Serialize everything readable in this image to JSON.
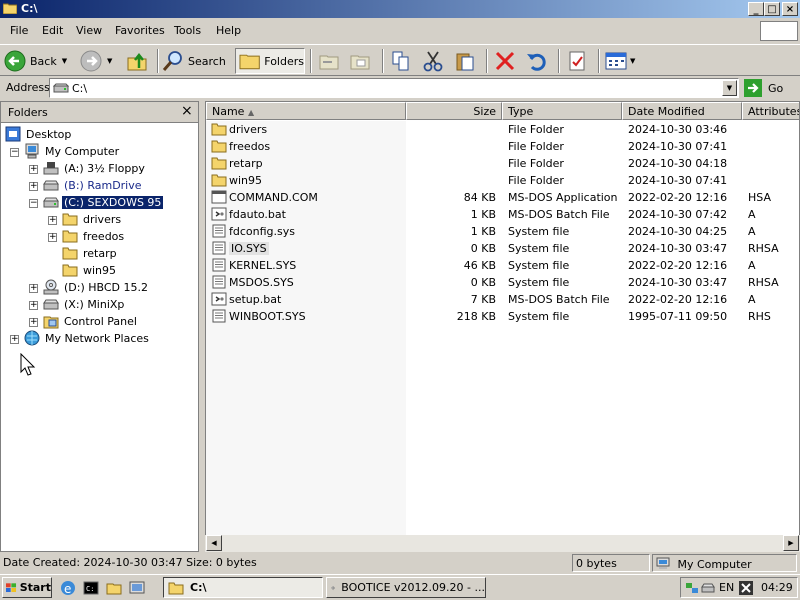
{
  "window": {
    "title": "C:\\",
    "min": "_",
    "max": "□",
    "close": "×"
  },
  "menu": [
    "File",
    "Edit",
    "View",
    "Favorites",
    "Tools",
    "Help"
  ],
  "toolbar": {
    "back": "Back",
    "search": "Search",
    "folders": "Folders"
  },
  "address": {
    "label": "Address",
    "value": "C:\\",
    "go": "Go"
  },
  "folders_pane": {
    "title": "Folders",
    "close": "×",
    "items": [
      {
        "label": "Desktop"
      },
      {
        "label": "My Computer"
      },
      {
        "label": "(A:) 3½ Floppy"
      },
      {
        "label": "(B:) RamDrive"
      },
      {
        "label": "(C:) SEXDOWS 95"
      },
      {
        "label": "drivers"
      },
      {
        "label": "freedos"
      },
      {
        "label": "retarp"
      },
      {
        "label": "win95"
      },
      {
        "label": "(D:) HBCD 15.2"
      },
      {
        "label": "(X:) MiniXp"
      },
      {
        "label": "Control Panel"
      },
      {
        "label": "My Network Places"
      }
    ]
  },
  "columns": {
    "name": "Name",
    "size": "Size",
    "type": "Type",
    "modified": "Date Modified",
    "attributes": "Attributes"
  },
  "files": [
    {
      "name": "drivers",
      "size": "",
      "type": "File Folder",
      "modified": "2024-10-30 03:46",
      "attr": "",
      "icon": "folder"
    },
    {
      "name": "freedos",
      "size": "",
      "type": "File Folder",
      "modified": "2024-10-30 07:41",
      "attr": "",
      "icon": "folder"
    },
    {
      "name": "retarp",
      "size": "",
      "type": "File Folder",
      "modified": "2024-10-30 04:18",
      "attr": "",
      "icon": "folder"
    },
    {
      "name": "win95",
      "size": "",
      "type": "File Folder",
      "modified": "2024-10-30 07:41",
      "attr": "",
      "icon": "folder"
    },
    {
      "name": "COMMAND.COM",
      "size": "84 KB",
      "type": "MS-DOS Application",
      "modified": "2022-02-20 12:16",
      "attr": "HSA",
      "icon": "app"
    },
    {
      "name": "fdauto.bat",
      "size": "1 KB",
      "type": "MS-DOS Batch File",
      "modified": "2024-10-30 07:42",
      "attr": "A",
      "icon": "bat"
    },
    {
      "name": "fdconfig.sys",
      "size": "1 KB",
      "type": "System file",
      "modified": "2024-10-30 04:25",
      "attr": "A",
      "icon": "sys"
    },
    {
      "name": "IO.SYS",
      "size": "0 KB",
      "type": "System file",
      "modified": "2024-10-30 03:47",
      "attr": "RHSA",
      "icon": "sys"
    },
    {
      "name": "KERNEL.SYS",
      "size": "46 KB",
      "type": "System file",
      "modified": "2022-02-20 12:16",
      "attr": "A",
      "icon": "sys"
    },
    {
      "name": "MSDOS.SYS",
      "size": "0 KB",
      "type": "System file",
      "modified": "2024-10-30 03:47",
      "attr": "RHSA",
      "icon": "sys"
    },
    {
      "name": "setup.bat",
      "size": "7 KB",
      "type": "MS-DOS Batch File",
      "modified": "2022-02-20 12:16",
      "attr": "A",
      "icon": "bat"
    },
    {
      "name": "WINBOOT.SYS",
      "size": "218 KB",
      "type": "System file",
      "modified": "1995-07-11 09:50",
      "attr": "RHS",
      "icon": "sys"
    }
  ],
  "status": {
    "details": "Date Created: 2024-10-30 03:47 Size: 0 bytes",
    "size": "0 bytes",
    "zone": "My Computer"
  },
  "taskbar": {
    "start": "Start",
    "task1": "C:\\",
    "task2": "BOOTICE v2012.09.20 - ...",
    "lang": "EN",
    "clock": "04:29"
  },
  "colors": {
    "titlebar_start": "#0a246a",
    "titlebar_end": "#a6caf0",
    "selection": "#0a246a",
    "folder": "#f4d46b"
  }
}
